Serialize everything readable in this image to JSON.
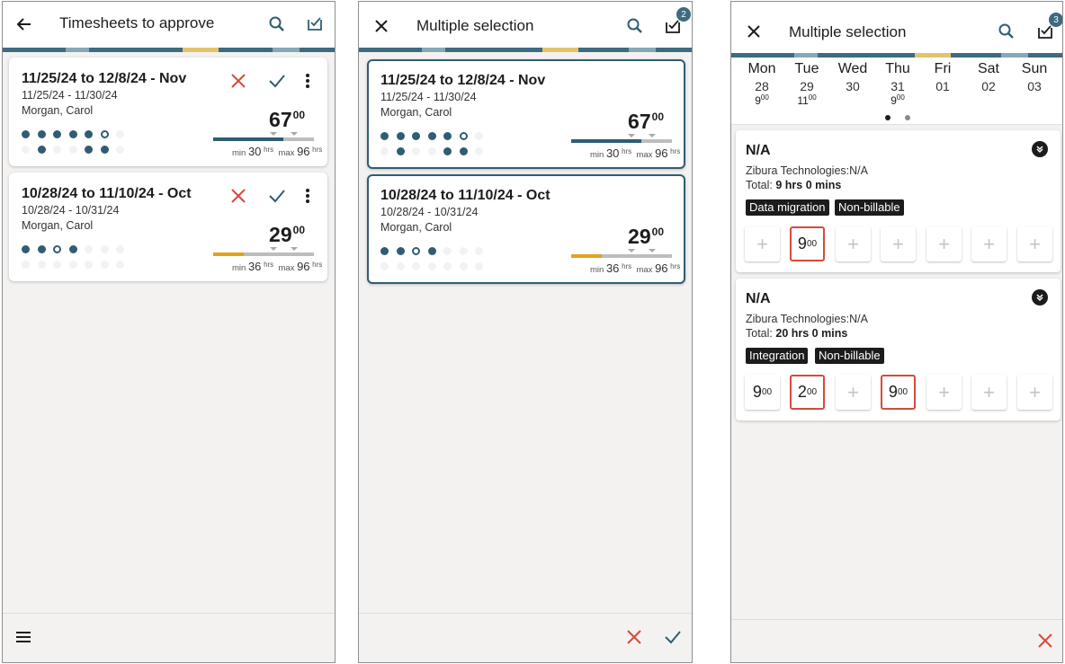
{
  "screen1": {
    "title": "Timesheets to approve",
    "cards": [
      {
        "title": "11/25/24 to 12/8/24 - Nov",
        "range": "11/25/24 - 11/30/24",
        "name": "Morgan, Carol",
        "total_main": "67",
        "total_sup": "00",
        "min_label": "min",
        "min": "30",
        "max_label": "max",
        "max": "96",
        "hrs": "hrs",
        "progress": 0.7,
        "fill_color": "#2f5d72"
      },
      {
        "title": "10/28/24 to 11/10/24 - Oct",
        "range": "10/28/24 - 10/31/24",
        "name": "Morgan, Carol",
        "total_main": "29",
        "total_sup": "00",
        "min_label": "min",
        "min": "36",
        "max_label": "max",
        "max": "96",
        "hrs": "hrs",
        "progress": 0.3,
        "fill_color": "#e3a21a"
      }
    ]
  },
  "screen2": {
    "title": "Multiple selection",
    "badge": "2",
    "cards": [
      {
        "title": "11/25/24 to 12/8/24 - Nov",
        "range": "11/25/24 - 11/30/24",
        "name": "Morgan, Carol",
        "total_main": "67",
        "total_sup": "00",
        "min_label": "min",
        "min": "30",
        "max_label": "max",
        "max": "96",
        "hrs": "hrs",
        "progress": 0.7,
        "fill_color": "#2f5d72"
      },
      {
        "title": "10/28/24 to 11/10/24 - Oct",
        "range": "10/28/24 - 10/31/24",
        "name": "Morgan, Carol",
        "total_main": "29",
        "total_sup": "00",
        "min_label": "min",
        "min": "36",
        "max_label": "max",
        "max": "96",
        "hrs": "hrs",
        "progress": 0.3,
        "fill_color": "#e3a21a"
      }
    ]
  },
  "screen3": {
    "title": "Multiple selection",
    "badge": "3",
    "days": [
      {
        "name": "Mon",
        "date": "28",
        "hours": "9",
        "sup": "00"
      },
      {
        "name": "Tue",
        "date": "29",
        "hours": "11",
        "sup": "00"
      },
      {
        "name": "Wed",
        "date": "30",
        "hours": "",
        "sup": ""
      },
      {
        "name": "Thu",
        "date": "31",
        "hours": "9",
        "sup": "00"
      },
      {
        "name": "Fri",
        "date": "01",
        "hours": "",
        "sup": ""
      },
      {
        "name": "Sat",
        "date": "02",
        "hours": "",
        "sup": ""
      },
      {
        "name": "Sun",
        "date": "03",
        "hours": "",
        "sup": ""
      }
    ],
    "entries": [
      {
        "title": "N/A",
        "company": "Zibura Technologies:N/A",
        "total_label": "Total:",
        "total": "9 hrs 0 mins",
        "chips": [
          "Data migration",
          "Non-billable"
        ],
        "cells": [
          {
            "v": "+"
          },
          {
            "v": "9",
            "s": "00",
            "red": true
          },
          {
            "v": "+"
          },
          {
            "v": "+"
          },
          {
            "v": "+"
          },
          {
            "v": "+"
          },
          {
            "v": "+"
          }
        ]
      },
      {
        "title": "N/A",
        "company": "Zibura Technologies:N/A",
        "total_label": "Total:",
        "total": "20 hrs 0 mins",
        "chips": [
          "Integration",
          "Non-billable"
        ],
        "cells": [
          {
            "v": "9",
            "s": "00"
          },
          {
            "v": "2",
            "s": "00",
            "red": true
          },
          {
            "v": "+"
          },
          {
            "v": "9",
            "s": "00",
            "red": true
          },
          {
            "v": "+"
          },
          {
            "v": "+"
          },
          {
            "v": "+"
          }
        ]
      }
    ]
  },
  "colors": {
    "primary": "#2f5d72",
    "reject": "#d64a3a",
    "accent": "#e3a21a"
  }
}
